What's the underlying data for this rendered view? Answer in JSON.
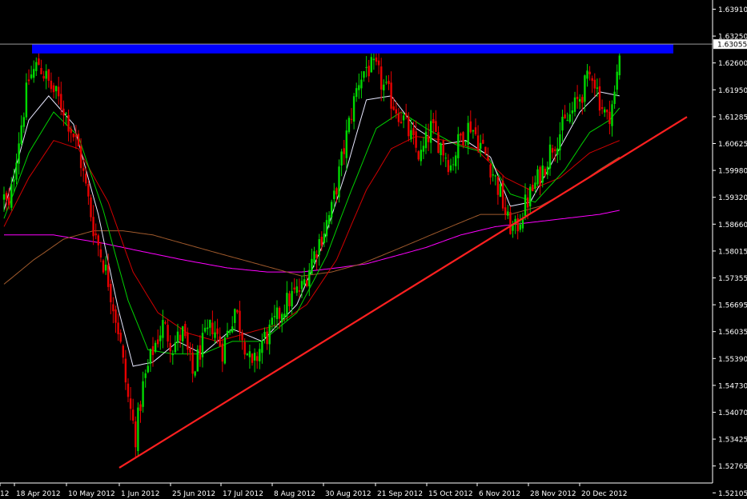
{
  "chart_data": {
    "type": "candlestick",
    "colors": {
      "background": "#000000",
      "up_candle": "#00d800",
      "down_candle": "#e80000",
      "resistance_zone": "#0000ff",
      "trendline": "#ff2020",
      "ema_fast": "#e8e8ff",
      "ema_mid": "#00d000",
      "ema_slow": "#d00000",
      "ma_200": "#ff00ff",
      "ma_100": "#a05a2c",
      "price_line": "#9a9a9a",
      "axis": "#ffffff"
    },
    "y_axis": {
      "ticks": [
        "1.63910",
        "1.63250",
        "1.62600",
        "1.61950",
        "1.61285",
        "1.60625",
        "1.59980",
        "1.59320",
        "1.58660",
        "1.58015",
        "1.57355",
        "1.56695",
        "1.56035",
        "1.55390",
        "1.54730",
        "1.54070",
        "1.53425",
        "1.52765",
        "1.52105"
      ],
      "range": [
        1.5204,
        1.6408
      ],
      "current_price": "1.63055"
    },
    "x_axis": {
      "ticks": [
        "12",
        "18 Apr 2012",
        "10 May 2012",
        "1 Jun 2012",
        "25 Jun 2012",
        "17 Jul 2012",
        "8 Aug 2012",
        "30 Aug 2012",
        "21 Sep 2012",
        "15 Oct 2012",
        "6 Nov 2012",
        "28 Nov 2012",
        "20 Dec 2012"
      ]
    },
    "resistance_zone": {
      "low": 1.6283,
      "high": 1.6305
    },
    "trendline": {
      "from": {
        "date": "1 Jun 2012",
        "value": 1.5272
      },
      "to": {
        "date": "2013",
        "value": 1.6128
      }
    },
    "series_waypoints": {
      "price": [
        [
          0,
          1.593
        ],
        [
          2,
          1.59
        ],
        [
          5,
          1.604
        ],
        [
          10,
          1.622
        ],
        [
          14,
          1.626
        ],
        [
          18,
          1.621
        ],
        [
          24,
          1.615
        ],
        [
          30,
          1.605
        ],
        [
          36,
          1.586
        ],
        [
          42,
          1.573
        ],
        [
          46,
          1.561
        ],
        [
          50,
          1.544
        ],
        [
          53,
          1.535
        ],
        [
          56,
          1.547
        ],
        [
          60,
          1.556
        ],
        [
          64,
          1.562
        ],
        [
          68,
          1.557
        ],
        [
          72,
          1.56
        ],
        [
          76,
          1.55
        ],
        [
          79,
          1.556
        ],
        [
          84,
          1.562
        ],
        [
          88,
          1.556
        ],
        [
          93,
          1.566
        ],
        [
          96,
          1.56
        ],
        [
          100,
          1.551
        ],
        [
          104,
          1.558
        ],
        [
          108,
          1.561
        ],
        [
          112,
          1.566
        ],
        [
          116,
          1.569
        ],
        [
          120,
          1.571
        ],
        [
          124,
          1.578
        ],
        [
          128,
          1.584
        ],
        [
          132,
          1.59
        ],
        [
          136,
          1.602
        ],
        [
          140,
          1.614
        ],
        [
          143,
          1.622
        ],
        [
          146,
          1.625
        ],
        [
          150,
          1.624
        ],
        [
          153,
          1.62
        ],
        [
          157,
          1.616
        ],
        [
          161,
          1.612
        ],
        [
          165,
          1.606
        ],
        [
          168,
          1.603
        ],
        [
          172,
          1.61
        ],
        [
          176,
          1.606
        ],
        [
          180,
          1.601
        ],
        [
          184,
          1.608
        ],
        [
          188,
          1.611
        ],
        [
          192,
          1.606
        ],
        [
          196,
          1.601
        ],
        [
          200,
          1.594
        ],
        [
          203,
          1.587
        ],
        [
          206,
          1.585
        ],
        [
          209,
          1.59
        ],
        [
          213,
          1.595
        ],
        [
          217,
          1.6
        ],
        [
          221,
          1.606
        ],
        [
          225,
          1.61
        ],
        [
          229,
          1.614
        ],
        [
          233,
          1.619
        ],
        [
          237,
          1.624
        ],
        [
          240,
          1.617
        ],
        [
          243,
          1.612
        ],
        [
          246,
          1.618
        ],
        [
          248,
          1.628
        ]
      ],
      "ema_fast": [
        [
          0,
          1.59
        ],
        [
          10,
          1.612
        ],
        [
          18,
          1.618
        ],
        [
          28,
          1.611
        ],
        [
          38,
          1.589
        ],
        [
          46,
          1.566
        ],
        [
          52,
          1.552
        ],
        [
          60,
          1.553
        ],
        [
          70,
          1.558
        ],
        [
          80,
          1.555
        ],
        [
          92,
          1.561
        ],
        [
          104,
          1.558
        ],
        [
          118,
          1.567
        ],
        [
          128,
          1.581
        ],
        [
          138,
          1.6
        ],
        [
          146,
          1.617
        ],
        [
          156,
          1.618
        ],
        [
          166,
          1.61
        ],
        [
          176,
          1.606
        ],
        [
          186,
          1.607
        ],
        [
          196,
          1.603
        ],
        [
          204,
          1.591
        ],
        [
          212,
          1.592
        ],
        [
          222,
          1.603
        ],
        [
          232,
          1.614
        ],
        [
          240,
          1.619
        ],
        [
          248,
          1.618
        ]
      ],
      "ema_mid": [
        [
          0,
          1.588
        ],
        [
          10,
          1.604
        ],
        [
          20,
          1.614
        ],
        [
          30,
          1.608
        ],
        [
          40,
          1.59
        ],
        [
          50,
          1.568
        ],
        [
          58,
          1.556
        ],
        [
          68,
          1.555
        ],
        [
          80,
          1.555
        ],
        [
          92,
          1.558
        ],
        [
          104,
          1.558
        ],
        [
          118,
          1.565
        ],
        [
          130,
          1.579
        ],
        [
          140,
          1.595
        ],
        [
          150,
          1.61
        ],
        [
          160,
          1.614
        ],
        [
          170,
          1.61
        ],
        [
          182,
          1.606
        ],
        [
          194,
          1.604
        ],
        [
          204,
          1.594
        ],
        [
          214,
          1.592
        ],
        [
          226,
          1.6
        ],
        [
          236,
          1.609
        ],
        [
          244,
          1.612
        ],
        [
          248,
          1.615
        ]
      ],
      "ema_slow": [
        [
          0,
          1.586
        ],
        [
          10,
          1.598
        ],
        [
          20,
          1.607
        ],
        [
          30,
          1.605
        ],
        [
          42,
          1.592
        ],
        [
          52,
          1.575
        ],
        [
          62,
          1.565
        ],
        [
          74,
          1.56
        ],
        [
          86,
          1.558
        ],
        [
          98,
          1.56
        ],
        [
          110,
          1.562
        ],
        [
          122,
          1.567
        ],
        [
          134,
          1.578
        ],
        [
          146,
          1.595
        ],
        [
          156,
          1.605
        ],
        [
          166,
          1.608
        ],
        [
          178,
          1.607
        ],
        [
          190,
          1.605
        ],
        [
          202,
          1.598
        ],
        [
          212,
          1.595
        ],
        [
          224,
          1.598
        ],
        [
          236,
          1.604
        ],
        [
          248,
          1.607
        ]
      ],
      "ma_100": [
        [
          0,
          1.572
        ],
        [
          12,
          1.578
        ],
        [
          24,
          1.583
        ],
        [
          36,
          1.585
        ],
        [
          48,
          1.585
        ],
        [
          60,
          1.584
        ],
        [
          72,
          1.582
        ],
        [
          84,
          1.58
        ],
        [
          96,
          1.578
        ],
        [
          108,
          1.576
        ],
        [
          120,
          1.574
        ],
        [
          132,
          1.575
        ],
        [
          144,
          1.577
        ],
        [
          156,
          1.58
        ],
        [
          168,
          1.583
        ],
        [
          180,
          1.586
        ],
        [
          192,
          1.589
        ],
        [
          204,
          1.589
        ],
        [
          216,
          1.591
        ],
        [
          228,
          1.595
        ],
        [
          240,
          1.6
        ],
        [
          248,
          1.603
        ]
      ],
      "ma_200": [
        [
          0,
          1.584
        ],
        [
          20,
          1.584
        ],
        [
          40,
          1.582
        ],
        [
          56,
          1.58
        ],
        [
          72,
          1.578
        ],
        [
          90,
          1.576
        ],
        [
          106,
          1.575
        ],
        [
          120,
          1.575
        ],
        [
          134,
          1.576
        ],
        [
          146,
          1.577
        ],
        [
          158,
          1.579
        ],
        [
          170,
          1.581
        ],
        [
          184,
          1.584
        ],
        [
          198,
          1.586
        ],
        [
          212,
          1.587
        ],
        [
          226,
          1.588
        ],
        [
          240,
          1.589
        ],
        [
          248,
          1.59
        ]
      ]
    }
  }
}
